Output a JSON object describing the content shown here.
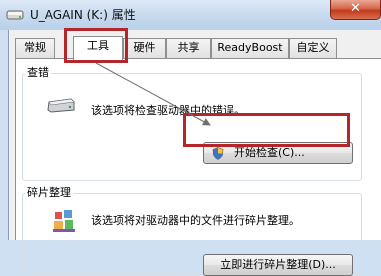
{
  "window": {
    "title": "U_AGAIN (K:) 属性",
    "close_glyph": "✕"
  },
  "tabs": [
    {
      "label": "常规",
      "active": false
    },
    {
      "label": "工具",
      "active": true
    },
    {
      "label": "硬件",
      "active": false
    },
    {
      "label": "共享",
      "active": false
    },
    {
      "label": "ReadyBoost",
      "active": false
    },
    {
      "label": "自定义",
      "active": false
    }
  ],
  "error_check": {
    "title": "查错",
    "description": "该选项将检查驱动器中的错误。",
    "button_label": "开始检查(C)..."
  },
  "defrag": {
    "title": "碎片整理",
    "description": "该选项将对驱动器中的文件进行碎片整理。",
    "button_label": "立即进行碎片整理(D)..."
  },
  "colors": {
    "highlight": "#b3262a",
    "titlebar": "#c6d9ef",
    "close_button": "#c4391c"
  },
  "icons": {
    "title": "drive-icon",
    "error_check": "drive-check-icon",
    "defrag": "defrag-icon",
    "uac": "uac-shield-icon"
  }
}
